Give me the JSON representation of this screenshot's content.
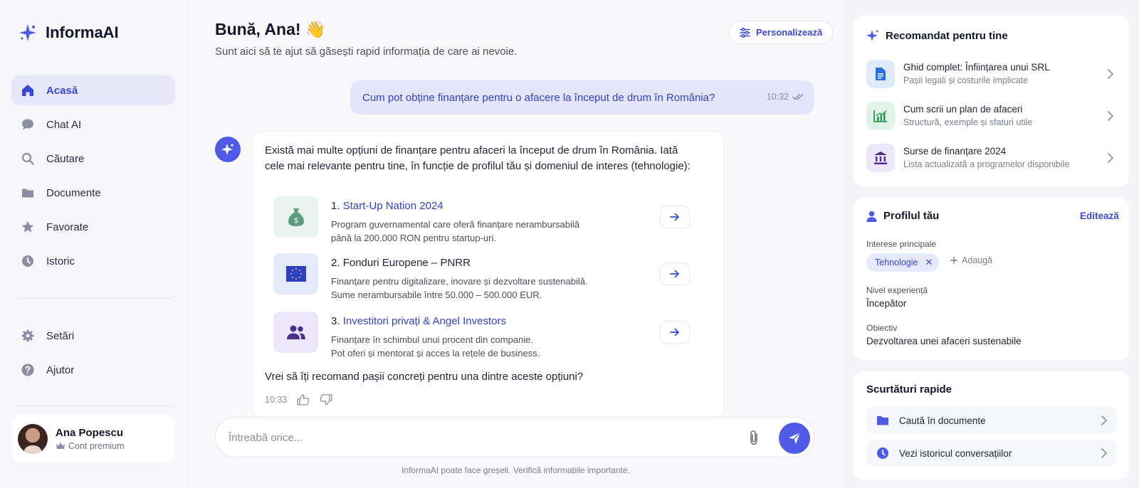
{
  "app": {
    "name": "InformaAI"
  },
  "colors": {
    "accent": "#4f5be6",
    "accent_text": "#3b47d6",
    "active_bg": "#e6e7fb"
  },
  "sidebar": {
    "items": [
      {
        "label": "Acasă",
        "icon": "home-icon",
        "active": true
      },
      {
        "label": "Chat AI",
        "icon": "chat-bubble-icon"
      },
      {
        "label": "Căutare",
        "icon": "search-icon"
      },
      {
        "label": "Documente",
        "icon": "folder-icon"
      },
      {
        "label": "Favorate",
        "icon": "star-icon"
      },
      {
        "label": "Istoric",
        "icon": "clock-icon"
      }
    ],
    "bottom_items": [
      {
        "label": "Setări",
        "icon": "gear-icon"
      },
      {
        "label": "Ajutor",
        "icon": "help-icon"
      }
    ],
    "user": {
      "name": "Ana Popescu",
      "plan": "Cont premium"
    }
  },
  "header": {
    "greeting": "Bună, Ana! 👋",
    "subtitle": "Sunt aici să te ajut să găsești rapid informația de care ai nevoie.",
    "personalize_label": "Personalizează"
  },
  "chat": {
    "user_message": {
      "text": "Cum pot obține finanțare pentru o afacere la început de drum în România?",
      "time": "10:32"
    },
    "bot_message": {
      "intro": "Există mai multe opțiuni de finanțare pentru afaceri la început de drum în România. Iată cele mai relevante pentru tine, în funcție de profilul tău și domeniul de interes (tehnologie):",
      "options": [
        {
          "number": "1.",
          "title": "Start-Up Nation 2024",
          "desc1": "Program guvernamental care oferă finanțare nerambursabilă",
          "desc2": "până la 200.000 RON pentru startup-uri.",
          "icon": "money-bag-icon"
        },
        {
          "number": "2.",
          "title": "Fonduri Europene – PNRR",
          "desc1": "Finanțare pentru digitalizare, inovare și dezvoltare sustenabilă.",
          "desc2": "Sume nerambursabile între 50.000 – 500.000 EUR.",
          "icon": "eu-flag-icon"
        },
        {
          "number": "3.",
          "title": "Investitori privați & Angel Investors",
          "desc1": "Finanțare în schimbul unui procent din companie.",
          "desc2": "Pot oferi și mentorat și acces la rețele de business.",
          "icon": "people-icon"
        }
      ],
      "question": "Vrei să îți recomand pașii concreți pentru una dintre aceste opțiuni?",
      "time": "10:33"
    },
    "input_placeholder": "Întreabă orice...",
    "disclaimer": "InformaAI poate face greșeli. Verifică informațiile importante."
  },
  "recommended": {
    "title": "Recomandat pentru tine",
    "items": [
      {
        "title": "Ghid complet: Înființarea unui SRL",
        "sub": "Pașii legali și costurile implicate",
        "icon": "document-icon"
      },
      {
        "title": "Cum scrii un plan de afaceri",
        "sub": "Structură, exemple și sfaturi utile",
        "icon": "chart-icon"
      },
      {
        "title": "Surse de finanțare 2024",
        "sub": "Lista actualizată a programelor disponibile",
        "icon": "bank-icon"
      }
    ]
  },
  "profile": {
    "title": "Profilul tău",
    "edit_label": "Editează",
    "interests_label": "Interese principale",
    "interest_chip": "Tehnologie",
    "add_label": "Adaugă",
    "level_label": "Nivel experiență",
    "level_value": "Începător",
    "goal_label": "Obiectiv",
    "goal_value": "Dezvoltarea unei afaceri sustenabile"
  },
  "shortcuts": {
    "title": "Scurtături rapide",
    "items": [
      {
        "label": "Caută în documente",
        "icon": "folder-icon"
      },
      {
        "label": "Vezi istoricul conversațiilor",
        "icon": "clock-icon"
      }
    ]
  }
}
